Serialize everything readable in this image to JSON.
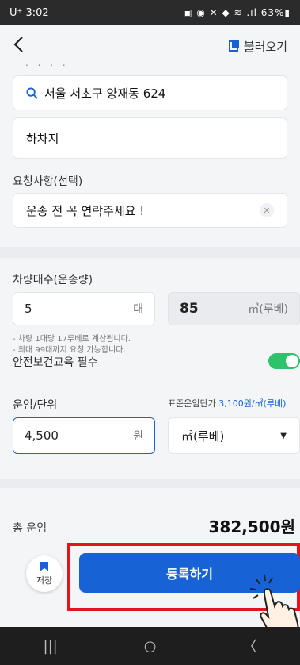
{
  "status_bar": {
    "time": "U⁺ 3:02",
    "indicators": "▣ ◉ ✕ ◆ ≋ .ıl 63%▮"
  },
  "header": {
    "back_icon": "back-arrow",
    "load_label": "불러오기"
  },
  "dots": ". . . .",
  "route": {
    "address": "서울 서초구 양재동 624",
    "unloading_label": "하차지"
  },
  "request": {
    "label": "요청사항(선택)",
    "value": "운송 전 꼭 연락주세요 !",
    "clear": "✕"
  },
  "vehicle": {
    "label": "차량대수(운송량)",
    "count": "5",
    "count_unit": "대",
    "volume": "85",
    "volume_unit": "㎥(루베)",
    "hint1": "- 차량 1대당 17루베로 계산됩니다.",
    "hint2": "- 최대 99대까지 요청 가능합니다."
  },
  "safety": {
    "label": "안전보건교육 필수",
    "enabled": true
  },
  "fare": {
    "label": "운임/단위",
    "std_label": "표준운임단가",
    "std_value": "3,100원/㎥(루베)",
    "value": "4,500",
    "value_unit": "원",
    "unit_select": "㎥(루베)",
    "caret": "▼"
  },
  "total": {
    "label": "총 운임",
    "value": "382,500원"
  },
  "actions": {
    "save_label": "저장",
    "register_label": "등록하기"
  },
  "nav": {
    "recent": "|||",
    "home": "○",
    "back": "〈"
  },
  "colors": {
    "primary": "#1763d6",
    "toggle_on": "#2ec26a",
    "highlight": "#e4141c"
  }
}
